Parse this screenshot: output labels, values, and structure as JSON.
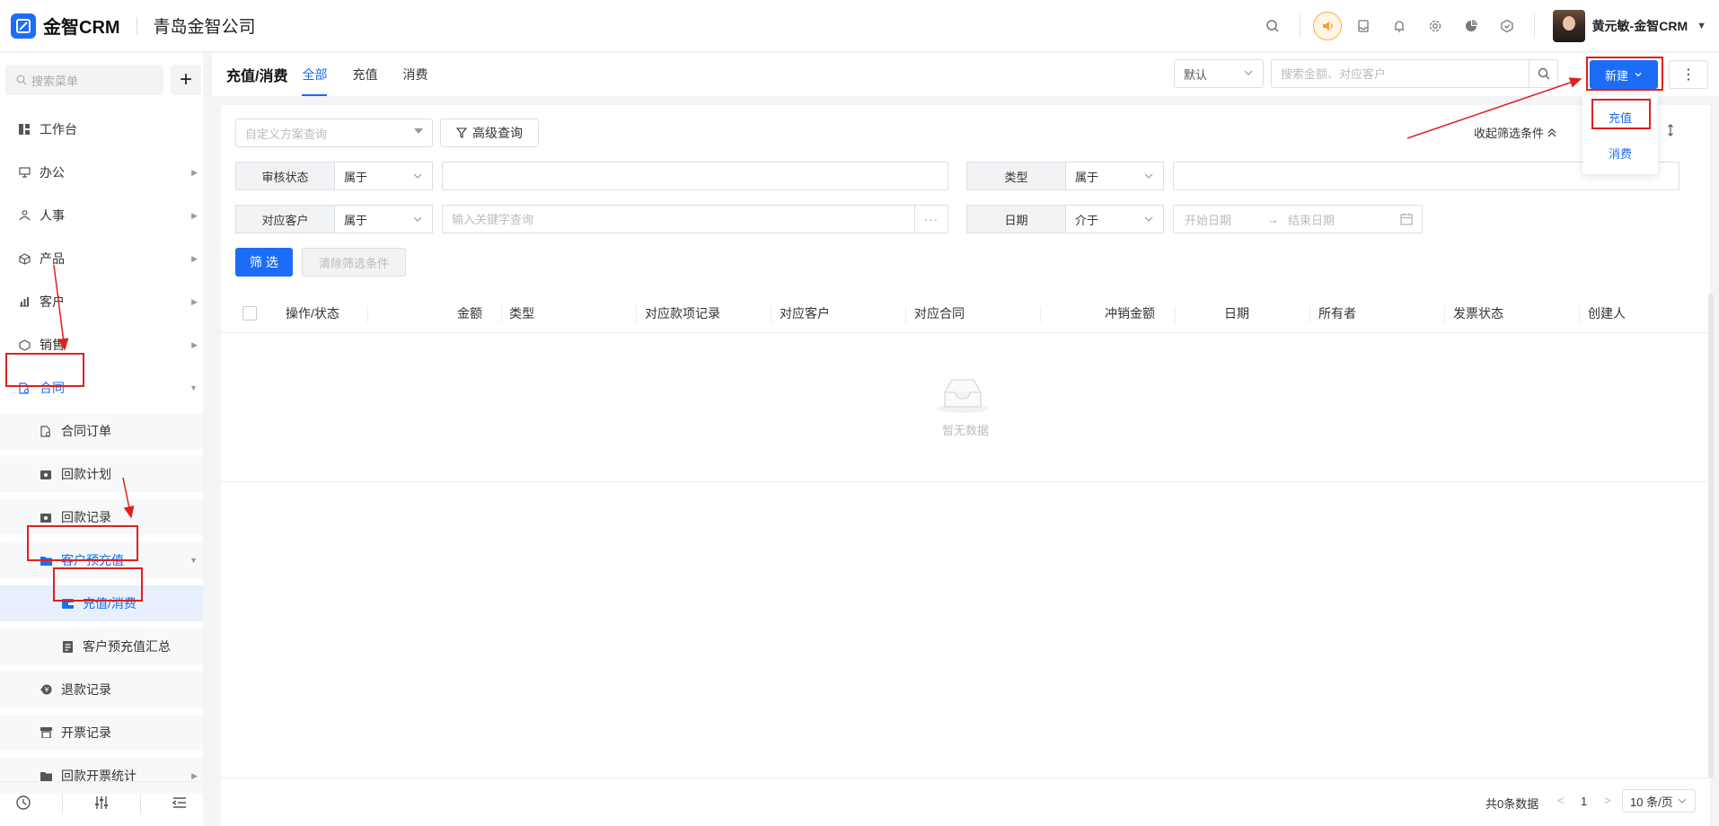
{
  "app": {
    "brand": "金智CRM",
    "company": "青岛金智公司",
    "user_name": "黄元敏-金智CRM",
    "accent_color": "#1c6cf5"
  },
  "header_icons": [
    "search-icon",
    "speaker-icon",
    "inbox-icon",
    "bell-icon",
    "gear-icon",
    "pie-chart-icon",
    "cube-icon"
  ],
  "sidebar": {
    "search_placeholder": "搜索菜单",
    "add_label": "+",
    "items": [
      {
        "label": "工作台",
        "icon": "dashboard-icon"
      },
      {
        "label": "办公",
        "icon": "monitor-icon"
      },
      {
        "label": "人事",
        "icon": "people-icon"
      },
      {
        "label": "产品",
        "icon": "box-icon"
      },
      {
        "label": "客户",
        "icon": "chart-icon"
      },
      {
        "label": "销售",
        "icon": "shield-icon"
      },
      {
        "label": "合同",
        "icon": "contract-icon"
      },
      {
        "label": "合同订单",
        "icon": "document-icon"
      },
      {
        "label": "回款计划",
        "icon": "wallet-icon"
      },
      {
        "label": "回款记录",
        "icon": "wallet-icon"
      },
      {
        "label": "客户预充值",
        "icon": "folder-icon"
      },
      {
        "label": "充值/消费",
        "icon": "card-icon"
      },
      {
        "label": "客户预充值汇总",
        "icon": "report-icon"
      },
      {
        "label": "退款记录",
        "icon": "refund-icon"
      },
      {
        "label": "开票记录",
        "icon": "printer-icon"
      },
      {
        "label": "回款开票统计",
        "icon": "folder-icon"
      }
    ],
    "footer_icons": [
      "history-icon",
      "sliders-icon",
      "menu-collapse-icon"
    ]
  },
  "page": {
    "title": "充值/消费",
    "tabs": [
      "全部",
      "充值",
      "消费"
    ],
    "view_select": "默认",
    "search_placeholder": "搜索金额、对应客户",
    "new_button": "新建",
    "more_button": "⋮",
    "new_menu": [
      "充值",
      "消费"
    ]
  },
  "filters": {
    "scheme_placeholder": "自定义方案查询",
    "advanced_query": "高级查询",
    "collapse_label": "收起筛选条件",
    "rows": [
      {
        "label": "审核状态",
        "op": "属于",
        "value": ""
      },
      {
        "label": "类型",
        "op": "属于",
        "value": ""
      },
      {
        "label": "对应客户",
        "op": "属于",
        "placeholder": "输入关键字查询",
        "more": "···"
      },
      {
        "label": "日期",
        "op": "介于",
        "start_placeholder": "开始日期",
        "arrow": "→",
        "end_placeholder": "结束日期"
      }
    ],
    "filter_button": "筛 选",
    "clear_button": "清除筛选条件"
  },
  "table": {
    "columns": [
      "操作/状态",
      "金额",
      "类型",
      "对应款项记录",
      "对应客户",
      "对应合同",
      "冲销金额",
      "日期",
      "所有者",
      "发票状态",
      "创建人"
    ],
    "empty_text": "暂无数据"
  },
  "pagination": {
    "total": "共0条数据",
    "prev": "<",
    "page": "1",
    "next": ">",
    "page_size": "10 条/页"
  }
}
